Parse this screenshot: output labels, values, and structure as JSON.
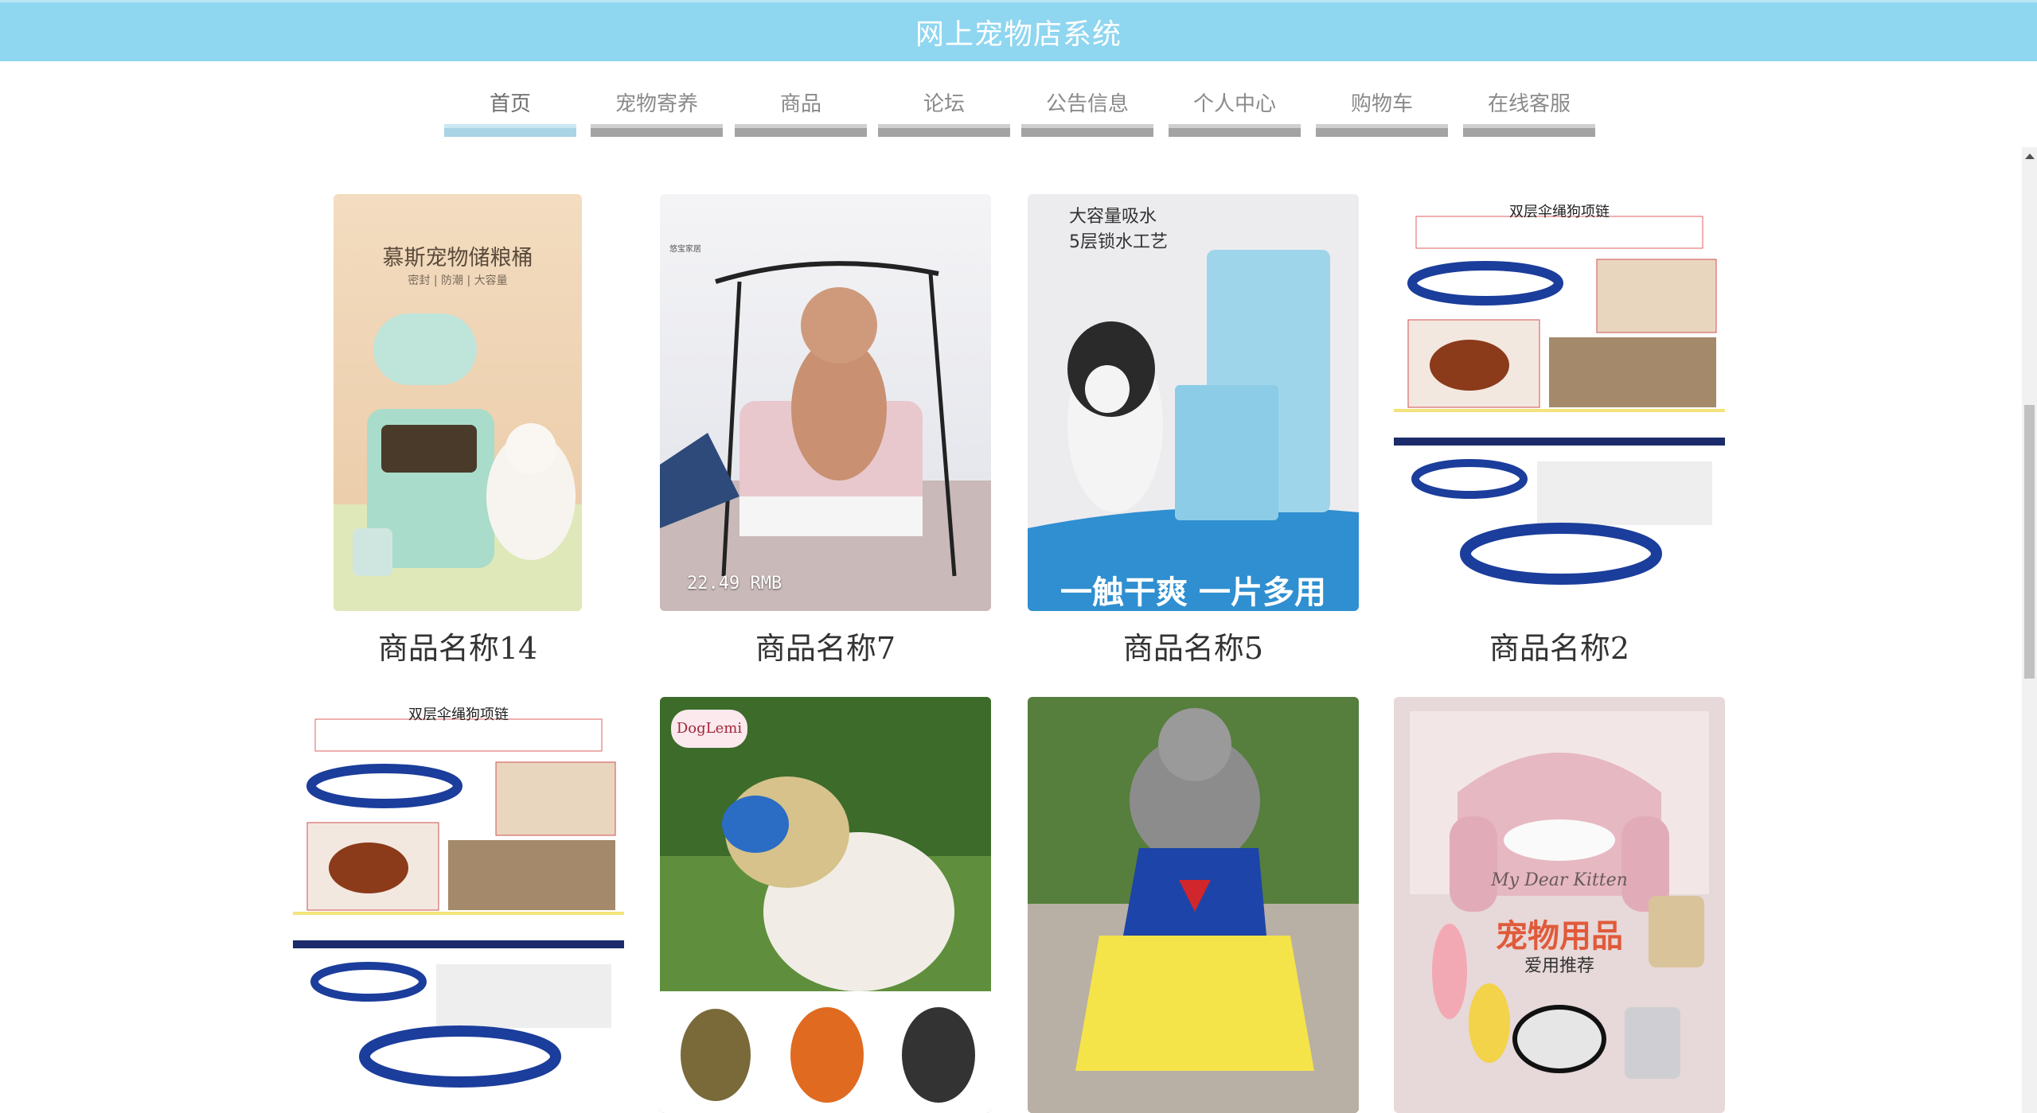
{
  "header": {
    "title": "网上宠物店系统"
  },
  "nav": {
    "items": [
      {
        "label": "首页",
        "active": true
      },
      {
        "label": "宠物寄养",
        "active": false
      },
      {
        "label": "商品",
        "active": false
      },
      {
        "label": "论坛",
        "active": false
      },
      {
        "label": "公告信息",
        "active": false
      },
      {
        "label": "个人中心",
        "active": false
      },
      {
        "label": "购物车",
        "active": false
      },
      {
        "label": "在线客服",
        "active": false
      }
    ]
  },
  "products": [
    {
      "name": "商品名称14",
      "image": "pet-food-storage-bin",
      "texts": {
        "headline": "慕斯宠物储粮桶",
        "sub": "密封 | 防潮 | 大容量"
      }
    },
    {
      "name": "商品名称7",
      "image": "poodle-on-swing",
      "texts": {
        "price": "22.49 RMB",
        "logo": "悠宝家居"
      }
    },
    {
      "name": "商品名称5",
      "image": "pet-training-pads",
      "texts": {
        "feature1": "大容量吸水",
        "feature2": "5层锁水工艺",
        "slogan": "一触干爽 一片多用"
      }
    },
    {
      "name": "商品名称2",
      "image": "braided-dog-collar",
      "texts": {
        "headline": "双层伞绳狗项链"
      }
    },
    {
      "name": "",
      "image": "braided-dog-collar",
      "texts": {
        "headline": "双层伞绳狗项链"
      }
    },
    {
      "name": "",
      "image": "dog-muzzle-mask",
      "texts": {
        "brand": "DogLemi"
      }
    },
    {
      "name": "",
      "image": "poodle-in-dress",
      "texts": {}
    },
    {
      "name": "",
      "image": "cat-sofa-bed",
      "texts": {
        "script": "My Dear Kitten",
        "headline": "宠物用品",
        "sub": "爱用推荐"
      }
    }
  ],
  "colors": {
    "header_bg": "#8fd6f0",
    "nav_active_bar": "#a9d4e6",
    "nav_bar": "#a3a3a3"
  }
}
